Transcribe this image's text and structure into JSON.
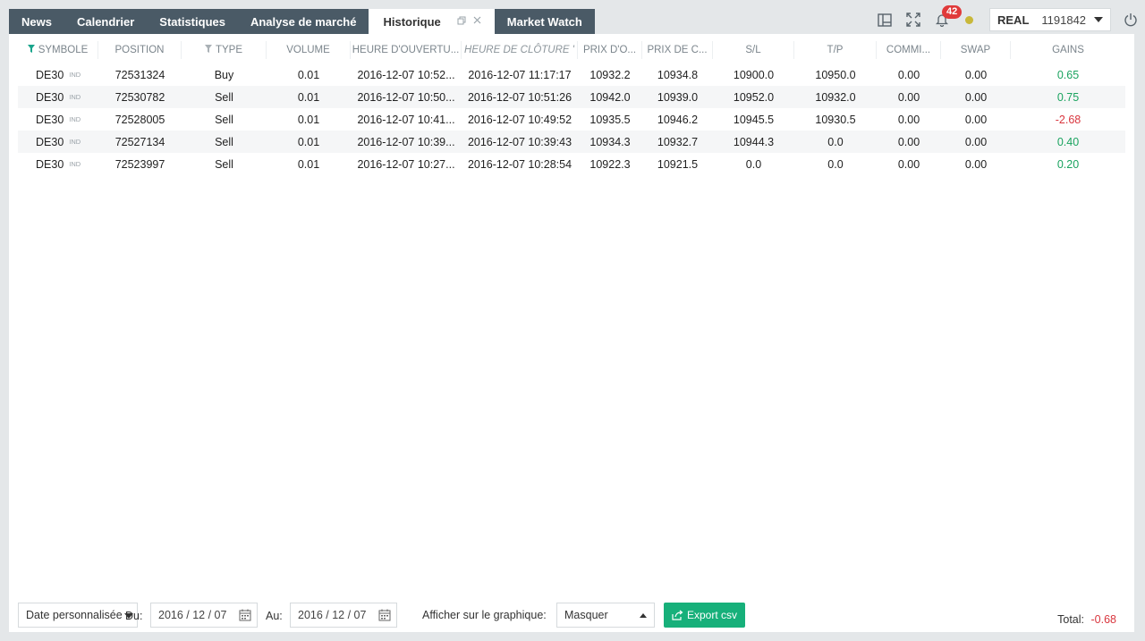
{
  "tabs": [
    {
      "label": "News"
    },
    {
      "label": "Calendrier"
    },
    {
      "label": "Statistiques"
    },
    {
      "label": "Analyse de marché"
    },
    {
      "label": "Historique",
      "active": true
    },
    {
      "label": "Market Watch"
    }
  ],
  "topbar": {
    "notification_count": "42",
    "account_mode": "REAL",
    "account_number": "1191842",
    "status_color": "#c8b83a",
    "icons": [
      "layout-icon",
      "fullscreen-icon",
      "bell-icon",
      "power-icon"
    ]
  },
  "table": {
    "columns": [
      "SYMBOLE",
      "POSITION",
      "TYPE",
      "VOLUME",
      "HEURE D'OUVERTU...",
      "HEURE DE CLÔTURE '",
      "PRIX D'O...",
      "PRIX DE C...",
      "S/L",
      "T/P",
      "COMMI...",
      "SWAP",
      "GAINS"
    ],
    "rows": [
      {
        "symbol": "DE30",
        "tag": "IND",
        "position": "72531324",
        "type": "Buy",
        "volume": "0.01",
        "open_time": "2016-12-07 10:52...",
        "close_time": "2016-12-07 11:17:17",
        "open_price": "10932.2",
        "close_price": "10934.8",
        "sl": "10900.0",
        "tp": "10950.0",
        "commission": "0.00",
        "swap": "0.00",
        "gain": "0.65"
      },
      {
        "symbol": "DE30",
        "tag": "IND",
        "position": "72530782",
        "type": "Sell",
        "volume": "0.01",
        "open_time": "2016-12-07 10:50...",
        "close_time": "2016-12-07 10:51:26",
        "open_price": "10942.0",
        "close_price": "10939.0",
        "sl": "10952.0",
        "tp": "10932.0",
        "commission": "0.00",
        "swap": "0.00",
        "gain": "0.75"
      },
      {
        "symbol": "DE30",
        "tag": "IND",
        "position": "72528005",
        "type": "Sell",
        "volume": "0.01",
        "open_time": "2016-12-07 10:41...",
        "close_time": "2016-12-07 10:49:52",
        "open_price": "10935.5",
        "close_price": "10946.2",
        "sl": "10945.5",
        "tp": "10930.5",
        "commission": "0.00",
        "swap": "0.00",
        "gain": "-2.68"
      },
      {
        "symbol": "DE30",
        "tag": "IND",
        "position": "72527134",
        "type": "Sell",
        "volume": "0.01",
        "open_time": "2016-12-07 10:39...",
        "close_time": "2016-12-07 10:39:43",
        "open_price": "10934.3",
        "close_price": "10932.7",
        "sl": "10944.3",
        "tp": "0.0",
        "commission": "0.00",
        "swap": "0.00",
        "gain": "0.40"
      },
      {
        "symbol": "DE30",
        "tag": "IND",
        "position": "72523997",
        "type": "Sell",
        "volume": "0.01",
        "open_time": "2016-12-07 10:27...",
        "close_time": "2016-12-07 10:28:54",
        "open_price": "10922.3",
        "close_price": "10921.5",
        "sl": "0.0",
        "tp": "0.0",
        "commission": "0.00",
        "swap": "0.00",
        "gain": "0.20"
      }
    ]
  },
  "footer": {
    "period_select": "Date personnalisée",
    "from_label": "Du:",
    "from_date": "2016 / 12 / 07",
    "to_label": "Au:",
    "to_date": "2016 / 12 / 07",
    "chart_label": "Afficher sur le graphique:",
    "chart_select": "Masquer",
    "export_label": "Export csv",
    "total_label": "Total:",
    "total_value": "-0.68"
  },
  "colors": {
    "tab_bg": "#4a5a66",
    "accent_green": "#17b07a",
    "gain_positive": "#1aa35f",
    "gain_negative": "#d9363e",
    "badge": "#e03a3a"
  }
}
